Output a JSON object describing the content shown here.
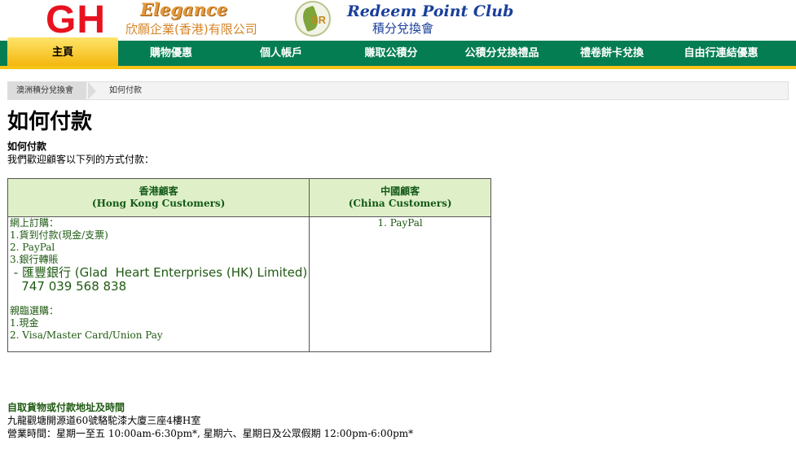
{
  "header": {
    "gh_logo": "GH",
    "elegance": "Elegance",
    "company_name": "欣願企業(香港)有限公司",
    "sr_logo_letters": "SR",
    "club_title": "Redeem Point Club",
    "club_subtitle": "積分兌換會"
  },
  "nav": {
    "items": [
      {
        "label": "主頁",
        "active": true
      },
      {
        "label": "購物優惠",
        "active": false
      },
      {
        "label": "個人帳戶",
        "active": false
      },
      {
        "label": "賺取公積分",
        "active": false
      },
      {
        "label": "公積分兌換禮品",
        "active": false
      },
      {
        "label": "禮卷餅卡兌換",
        "active": false
      },
      {
        "label": "自由行連結優惠",
        "active": false
      }
    ],
    "accent_color": "#057d52",
    "active_color": "#f6c316"
  },
  "breadcrumb": {
    "home": "澳洲積分兌換會",
    "current": "如何付款"
  },
  "main": {
    "title": "如何付款",
    "sub_heading": "如何付款",
    "intro": "我們歡迎顧客以下列的方式付款："
  },
  "payment_table": {
    "hk_header": "香港顧客",
    "hk_header_en": "(Hong Kong Customers)",
    "cn_header": "中國顧客",
    "cn_header_en": "(China Customers)",
    "hk": {
      "online_title": "網上訂購：",
      "online_1": "1.貨到付款(現金/支票)",
      "online_2": "2. PayPal",
      "online_3": "3.銀行轉賬",
      "bank_name": " - 匯豐銀行 (Glad  Heart Enterprises (HK) Limited)",
      "bank_account": "   747 039 568 838",
      "visit_title": "親臨選購：",
      "visit_1": "1.現金",
      "visit_2": "2. Visa/Master Card/Union Pay"
    },
    "cn": {
      "method_1": "1. PayPal"
    }
  },
  "pickup": {
    "title": "自取貨物或付款地址及時間",
    "address": "九龍觀塘開源道60號駱駝漆大廈三座4樓H室",
    "hours": "營業時間：星期一至五 10:00am-6:30pm*, 星期六、星期日及公眾假期 12:00pm-6:00pm*"
  }
}
